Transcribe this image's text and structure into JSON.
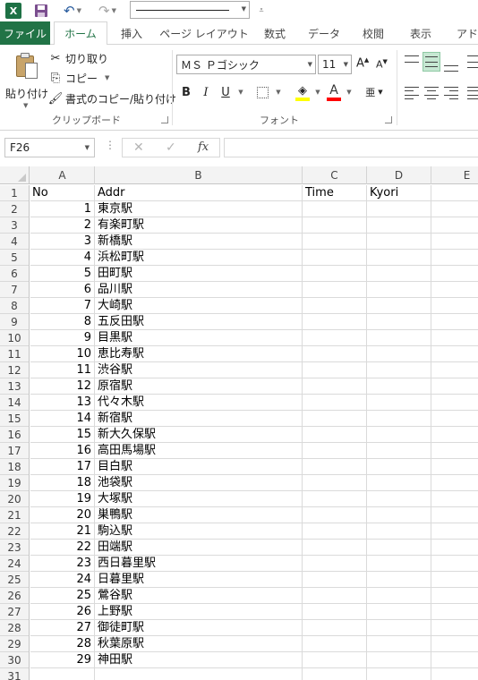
{
  "qat": {
    "app_logo": "X",
    "icons": [
      "excel-logo",
      "save-icon",
      "undo-icon",
      "redo-icon",
      "customize-icon"
    ]
  },
  "tabs": [
    {
      "id": "file",
      "label": "ファイル"
    },
    {
      "id": "home",
      "label": "ホーム",
      "active": true
    },
    {
      "id": "insert",
      "label": "挿入"
    },
    {
      "id": "layout",
      "label": "ページ レイアウト"
    },
    {
      "id": "formulas",
      "label": "数式"
    },
    {
      "id": "data",
      "label": "データ"
    },
    {
      "id": "review",
      "label": "校閲"
    },
    {
      "id": "view",
      "label": "表示"
    },
    {
      "id": "addin",
      "label": "アドイ"
    }
  ],
  "ribbon": {
    "clipboard": {
      "paste_label": "貼り付け",
      "cut_label": "切り取り",
      "copy_label": "コピー",
      "format_painter_label": "書式のコピー/貼り付け",
      "group_label": "クリップボード"
    },
    "font": {
      "font_name": "ＭＳ Ｐゴシック",
      "font_size": "11",
      "grow_label": "A",
      "shrink_label": "A",
      "bold_label": "B",
      "italic_label": "I",
      "underline_label": "U",
      "fill_color": "#ffff00",
      "font_color": "#ff0000",
      "font_color_label": "A",
      "phonetic_label": "亜",
      "group_label": "フォント"
    }
  },
  "formula_bar": {
    "name_box": "F26",
    "fx_label": "fx",
    "formula": ""
  },
  "sheet": {
    "columns": [
      "A",
      "B",
      "C",
      "D",
      "E"
    ],
    "header_row": {
      "A": "No",
      "B": "Addr",
      "C": "Time",
      "D": "Kyori"
    },
    "rows": [
      {
        "no": "1",
        "addr": "東京駅"
      },
      {
        "no": "2",
        "addr": "有楽町駅"
      },
      {
        "no": "3",
        "addr": "新橋駅"
      },
      {
        "no": "4",
        "addr": "浜松町駅"
      },
      {
        "no": "5",
        "addr": "田町駅"
      },
      {
        "no": "6",
        "addr": "品川駅"
      },
      {
        "no": "7",
        "addr": "大崎駅"
      },
      {
        "no": "8",
        "addr": "五反田駅"
      },
      {
        "no": "9",
        "addr": "目黒駅"
      },
      {
        "no": "10",
        "addr": "恵比寿駅"
      },
      {
        "no": "11",
        "addr": "渋谷駅"
      },
      {
        "no": "12",
        "addr": "原宿駅"
      },
      {
        "no": "13",
        "addr": "代々木駅"
      },
      {
        "no": "14",
        "addr": "新宿駅"
      },
      {
        "no": "15",
        "addr": "新大久保駅"
      },
      {
        "no": "16",
        "addr": "高田馬場駅"
      },
      {
        "no": "17",
        "addr": "目白駅"
      },
      {
        "no": "18",
        "addr": "池袋駅"
      },
      {
        "no": "19",
        "addr": "大塚駅"
      },
      {
        "no": "20",
        "addr": "巣鴨駅"
      },
      {
        "no": "21",
        "addr": "駒込駅"
      },
      {
        "no": "22",
        "addr": "田端駅"
      },
      {
        "no": "23",
        "addr": "西日暮里駅"
      },
      {
        "no": "24",
        "addr": "日暮里駅"
      },
      {
        "no": "25",
        "addr": "鶯谷駅"
      },
      {
        "no": "26",
        "addr": "上野駅"
      },
      {
        "no": "27",
        "addr": "御徒町駅"
      },
      {
        "no": "28",
        "addr": "秋葉原駅"
      },
      {
        "no": "29",
        "addr": "神田駅"
      }
    ],
    "row_numbers": [
      "1",
      "2",
      "3",
      "4",
      "5",
      "6",
      "7",
      "8",
      "9",
      "10",
      "11",
      "12",
      "13",
      "14",
      "15",
      "16",
      "17",
      "18",
      "19",
      "20",
      "21",
      "22",
      "23",
      "24",
      "25",
      "26",
      "27",
      "28",
      "29",
      "30",
      "31"
    ],
    "selected_cell": "F26"
  },
  "colors": {
    "brand_green": "#217346",
    "excel_logo_green": "#1e7145",
    "align_selected_bg": "#c6e7d2"
  }
}
